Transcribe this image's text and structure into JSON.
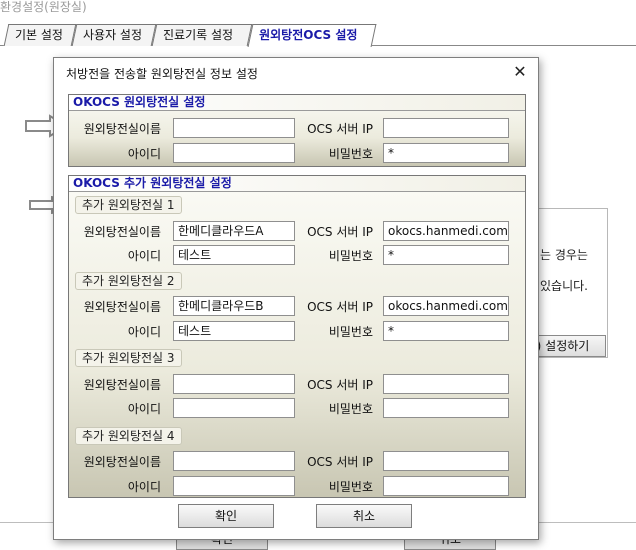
{
  "window": {
    "title": "환경설정(원장실)"
  },
  "tabs": [
    {
      "label": "기본 설정"
    },
    {
      "label": "사용자 설정"
    },
    {
      "label": "진료기록 설정"
    },
    {
      "label": "원외탕전OCS 설정",
      "active": true
    }
  ],
  "background": {
    "text1": "는 경우는",
    "text2": "있습니다.",
    "setup_button": ") 설정하기",
    "ok_button": "확인",
    "cancel_button": "취소"
  },
  "dialog": {
    "title": "처방전을 전송할 원외탕전실 정보 설정",
    "primary": {
      "header": "OKOCS 원외탕전실 설정",
      "name_label": "원외탕전실이름",
      "name_value": "",
      "server_label": "OCS 서버 IP",
      "server_value": "",
      "id_label": "아이디",
      "id_value": "",
      "pw_label": "비밀번호",
      "pw_value": "*"
    },
    "additional": {
      "header": "OKOCS 추가 원외탕전실 설정",
      "rooms": [
        {
          "title": "추가 원외탕전실 1",
          "name_label": "원외탕전실이름",
          "name_value": "한메디클라우드A",
          "server_label": "OCS 서버 IP",
          "server_value": "okocs.hanmedi.com/",
          "id_label": "아이디",
          "id_value": "테스트",
          "pw_label": "비밀번호",
          "pw_value": "*"
        },
        {
          "title": "추가 원외탕전실 2",
          "name_label": "원외탕전실이름",
          "name_value": "한메디클라우드B",
          "server_label": "OCS 서버 IP",
          "server_value": "okocs.hanmedi.com/",
          "id_label": "아이디",
          "id_value": "테스트",
          "pw_label": "비밀번호",
          "pw_value": "*"
        },
        {
          "title": "추가 원외탕전실 3",
          "name_label": "원외탕전실이름",
          "name_value": "",
          "server_label": "OCS 서버 IP",
          "server_value": "",
          "id_label": "아이디",
          "id_value": "",
          "pw_label": "비밀번호",
          "pw_value": ""
        },
        {
          "title": "추가 원외탕전실 4",
          "name_label": "원외탕전실이름",
          "name_value": "",
          "server_label": "OCS 서버 IP",
          "server_value": "",
          "id_label": "아이디",
          "id_value": "",
          "pw_label": "비밀번호",
          "pw_value": ""
        }
      ]
    },
    "ok_button": "확인",
    "cancel_button": "취소"
  },
  "icons": {
    "close": "close-icon",
    "annotation": "arrow-right-icon"
  },
  "colors": {
    "group_header_text": "#1a1aa8",
    "active_tab_text": "#1a1aa8"
  }
}
